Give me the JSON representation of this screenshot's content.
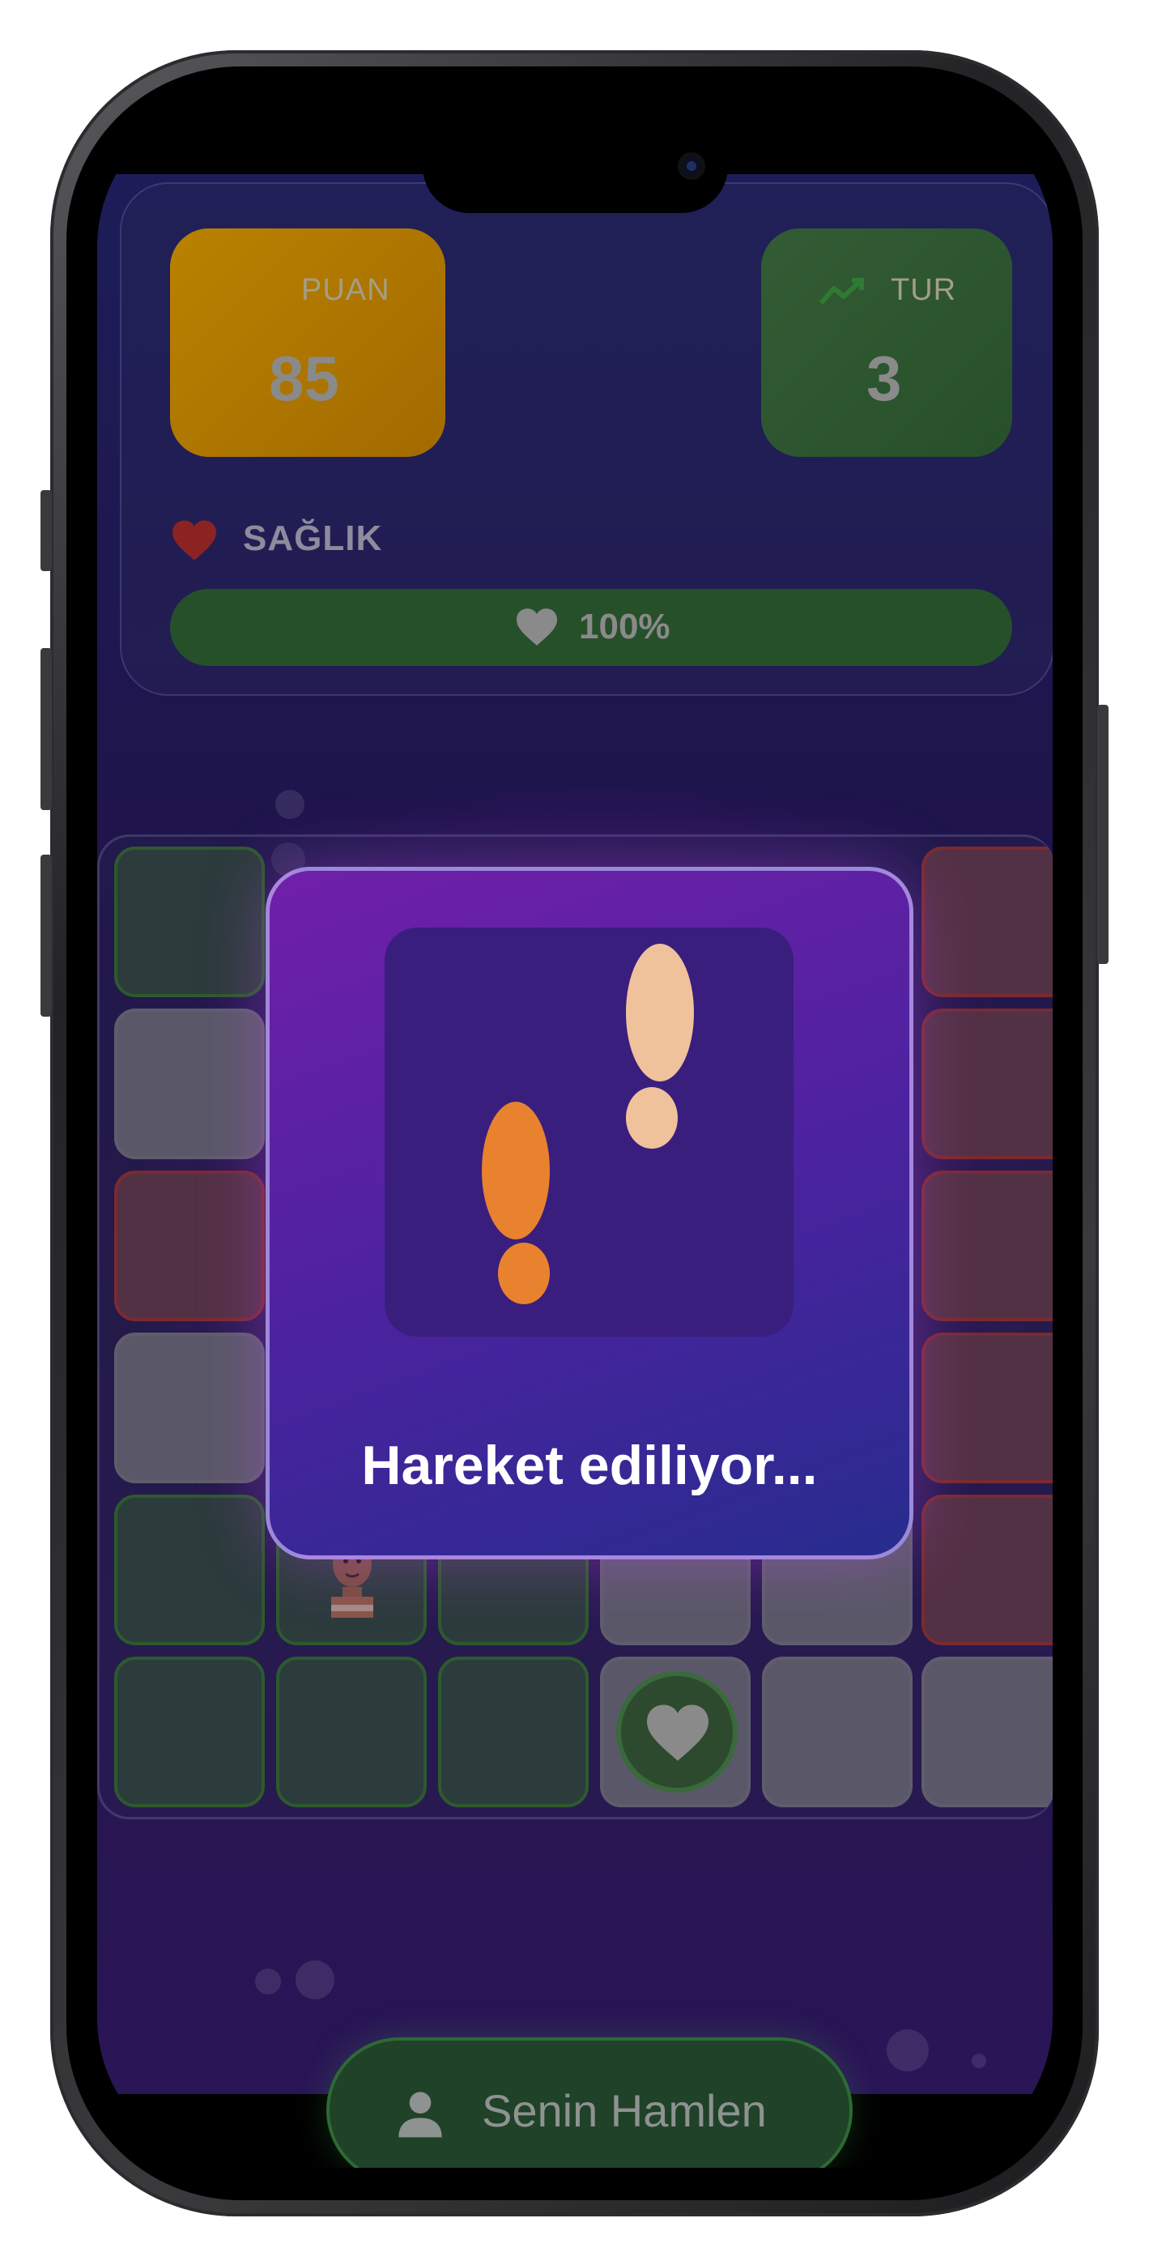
{
  "stats": {
    "score_label": "PUAN",
    "score_value": "85",
    "round_label": "TUR",
    "round_value": "3"
  },
  "health": {
    "label": "SAĞLIK",
    "value_text": "100%",
    "value": 1.0
  },
  "board": {
    "rows": 6,
    "cols": 6
  },
  "overlay": {
    "message": "Hareket ediliyor...",
    "icon": "footsteps-icon"
  },
  "turn_button": {
    "label": "Senin Hamlen",
    "icon": "person-icon"
  },
  "colors": {
    "score_card": "#b98200",
    "round_card": "#335c35",
    "health_bar": "#26502a",
    "overlay_top": "#7020a8",
    "overlay_bottom": "#272c8e",
    "footprint_near": "#e8822e",
    "footprint_far": "#efc29b"
  }
}
